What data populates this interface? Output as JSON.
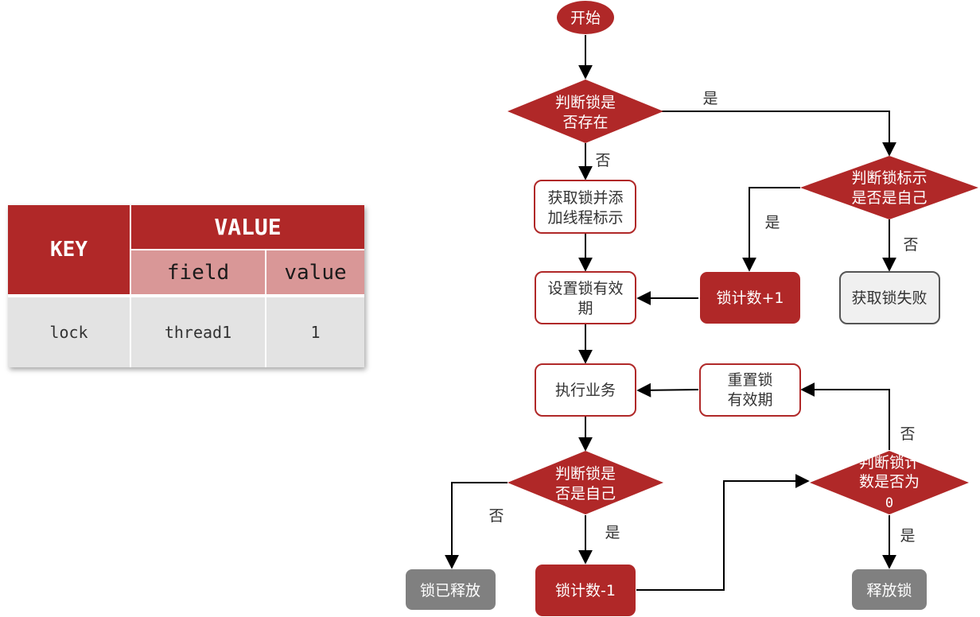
{
  "table": {
    "key_header": "KEY",
    "value_header": "VALUE",
    "field_header": "field",
    "value_col_header": "value",
    "rows": [
      {
        "key": "lock",
        "field": "thread1",
        "value": "1"
      }
    ]
  },
  "flowchart": {
    "nodes": {
      "start": [
        "开始"
      ],
      "lock_exists": [
        "判断锁是",
        "否存在"
      ],
      "acquire_lock": [
        "获取锁并添",
        "加线程标示"
      ],
      "is_self_top": [
        "判断锁标示",
        "是否是自己"
      ],
      "count_plus": [
        "锁计数+1"
      ],
      "acquire_fail": [
        "获取锁失败"
      ],
      "set_expiry": [
        "设置锁有效",
        "期"
      ],
      "run_business": [
        "执行业务"
      ],
      "reset_expiry": [
        "重置锁",
        "有效期"
      ],
      "is_self_bottom": [
        "判断锁是",
        "否是自己"
      ],
      "count_zero": [
        "判断锁计",
        "数是否为",
        "0"
      ],
      "released": [
        "锁已释放"
      ],
      "count_minus": [
        "锁计数-1"
      ],
      "release_lock": [
        "释放锁"
      ]
    },
    "edge_labels": {
      "exists_yes": "是",
      "exists_no": "否",
      "self_top_yes": "是",
      "self_top_no": "否",
      "self_bottom_no": "否",
      "self_bottom_yes": "是",
      "zero_no": "否",
      "zero_yes": "是"
    },
    "colors": {
      "accent": "#b02828",
      "outline": "#b02828",
      "gray": "#808080",
      "light_gray": "#f0f0f0",
      "line": "#000000"
    }
  }
}
